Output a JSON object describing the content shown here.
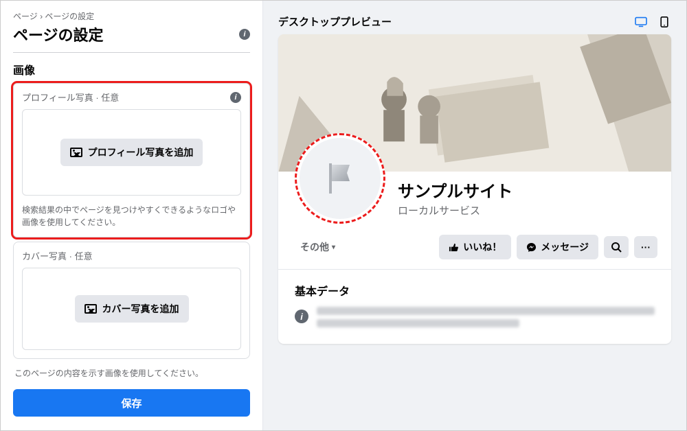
{
  "breadcrumb": "ページ › ページの設定",
  "title": "ページの設定",
  "section": "画像",
  "profile": {
    "label": "プロフィール写真",
    "optional": " · 任意",
    "button": "プロフィール写真を追加",
    "hint": "検索結果の中でページを見つけやすくできるようなロゴや画像を使用してください。"
  },
  "cover": {
    "label": "カバー写真",
    "optional": " · 任意",
    "button": "カバー写真を追加",
    "hint": "このページの内容を示す画像を使用してください。"
  },
  "save": "保存",
  "preview": {
    "title": "デスクトッププレビュー",
    "page_name": "サンプルサイト",
    "category": "ローカルサービス",
    "tab_other": "その他",
    "like": "いいね！",
    "message": "メッセージ",
    "more": "···",
    "basic_data": "基本データ"
  }
}
